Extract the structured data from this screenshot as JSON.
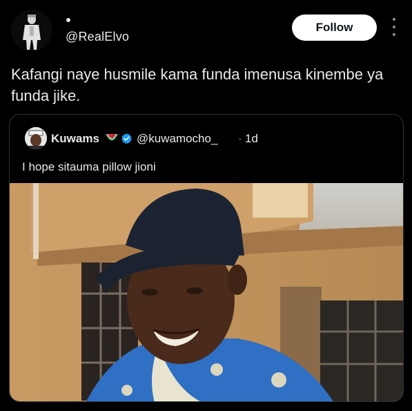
{
  "post": {
    "author_handle": "@RealElvo",
    "follow_label": "Follow",
    "text": "Kafangi naye husmile kama funda imenusa kinembe ya funda jike."
  },
  "quote": {
    "name": "Kuwams",
    "emoji": "watermelon-icon",
    "verified": true,
    "handle": "@kuwamocho_",
    "separator": "·",
    "time": "1d",
    "text": "I hope sitauma pillow jioni"
  },
  "colors": {
    "background": "#000000",
    "text": "#e7e9ea",
    "muted": "#8b8f94",
    "border": "#2f3336",
    "verified": "#1d9bf0",
    "follow_bg": "#ffffff"
  }
}
